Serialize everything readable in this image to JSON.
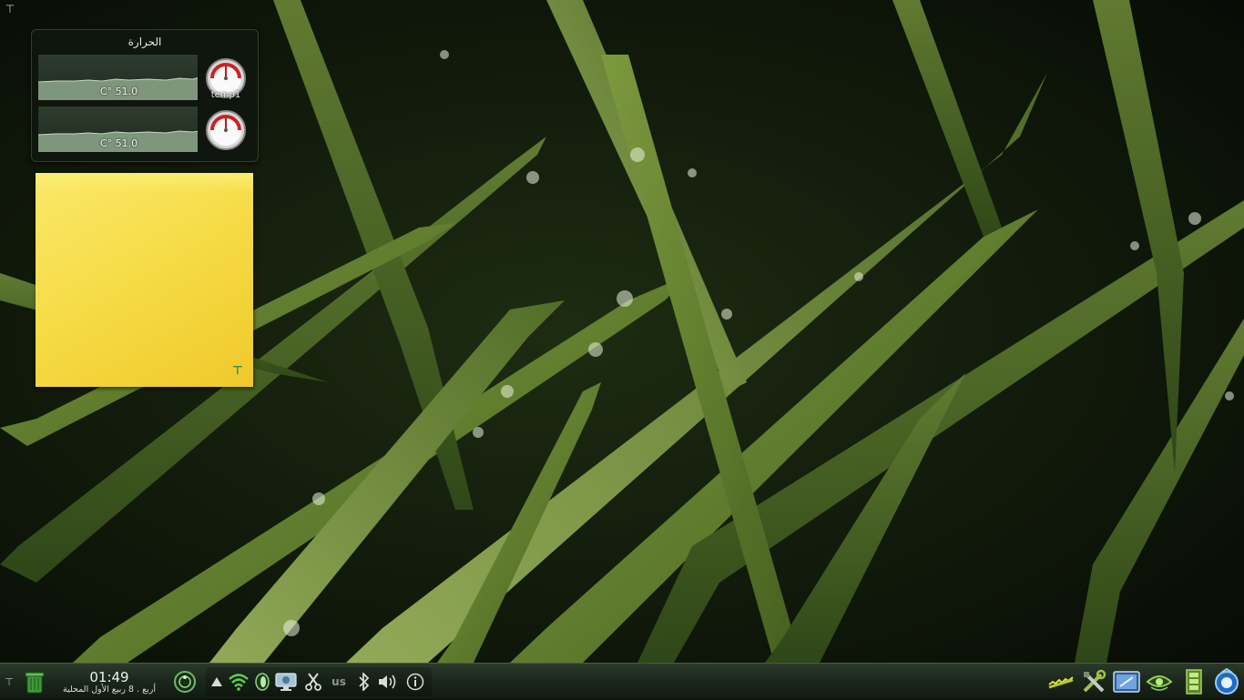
{
  "temperature_widget": {
    "title": "الحرارة",
    "sensors": [
      {
        "value": "C° 51.0",
        "label": "temp1"
      },
      {
        "value": "C° 51.0",
        "label": ""
      }
    ]
  },
  "panel": {
    "clock": {
      "time": "01:49",
      "date": "أربع . 8 ربيع الأول المحلية"
    },
    "tray": {
      "keyboard_layout": "us"
    }
  },
  "icons": {
    "corner": "toolbox-icon",
    "trash": "trash-icon",
    "activity": "activity-manager-icon",
    "tray": [
      "show-hidden-arrow-icon",
      "wifi-icon",
      "tomahawk-icon",
      "display-icon",
      "scissors-icon",
      "keyboard-layout-icon",
      "bluetooth-icon",
      "volume-icon",
      "info-icon"
    ],
    "launchers": [
      "network-monitor-icon",
      "tools-icon",
      "screenshot-icon",
      "eye-icon",
      "film-icon",
      "application-menu-icon"
    ]
  },
  "colors": {
    "note_yellow": "#f6dc48",
    "panel_dark": "#1c281c",
    "gauge_red": "#cc2222"
  }
}
